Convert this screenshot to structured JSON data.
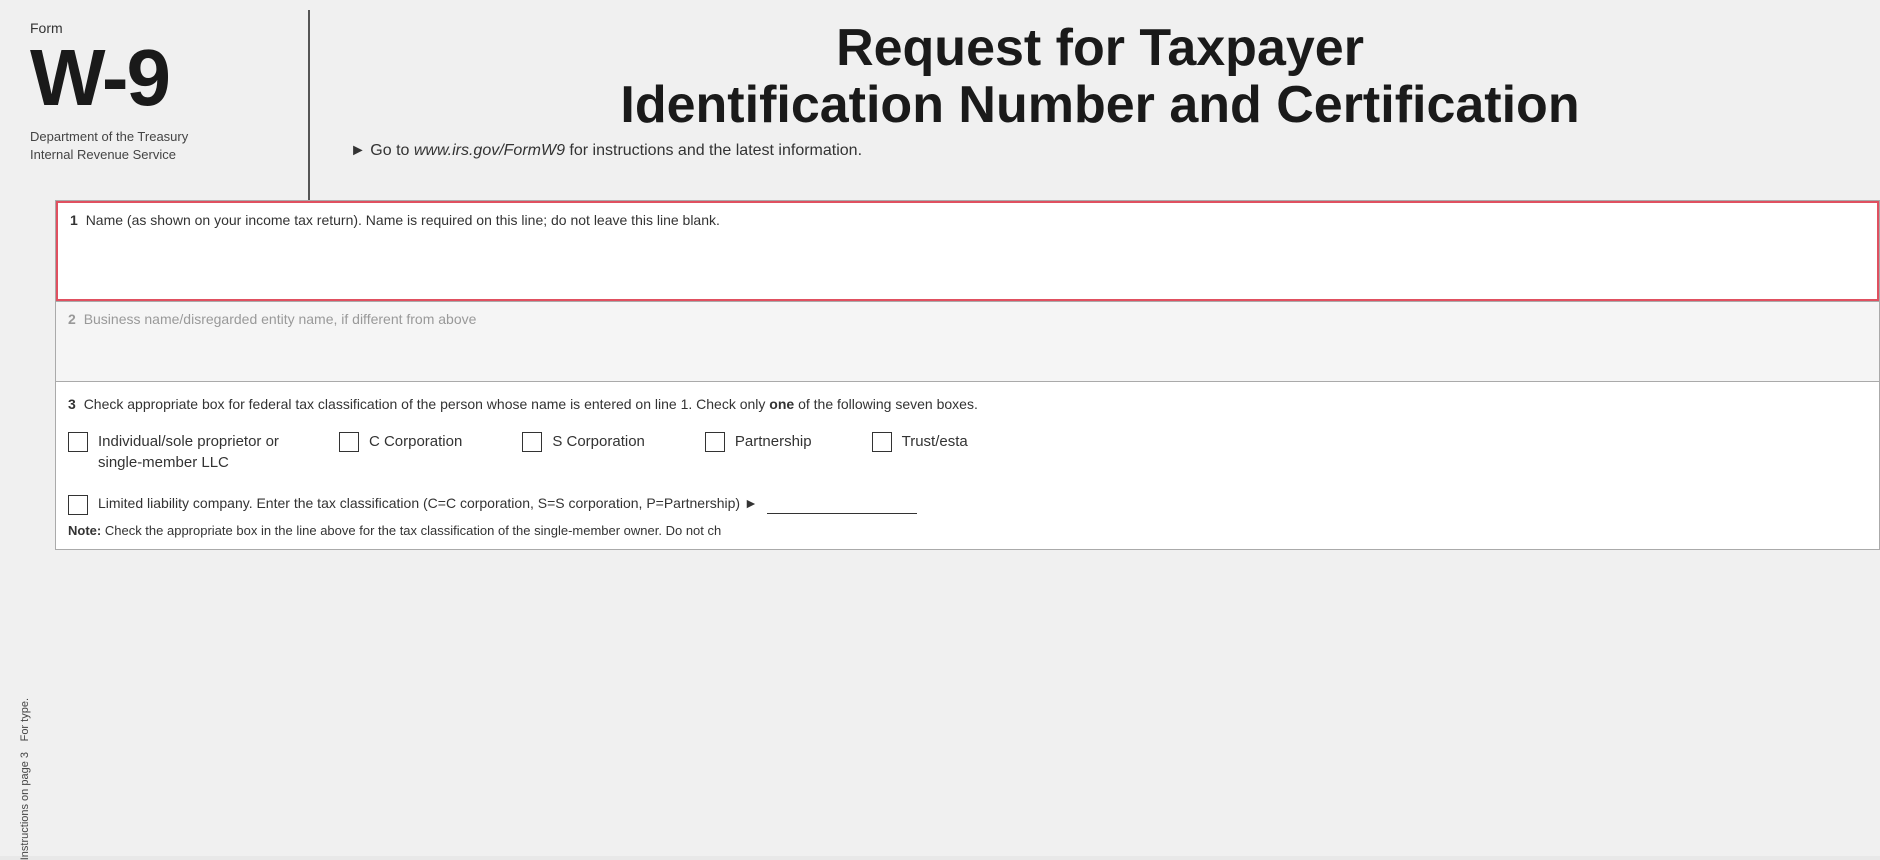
{
  "header": {
    "form_label": "Form",
    "form_number": "W-9",
    "title_line1": "Request for Taxpayer",
    "title_line2": "Identification Number and Certification",
    "department": "Department of the Treasury",
    "revenue_service": "Internal Revenue Service",
    "irs_instruction": "► Go to ",
    "irs_url": "www.irs.gov/FormW9",
    "irs_instruction_end": " for instructions and the latest information."
  },
  "sidebar": {
    "rotated_text1": "For type.",
    "rotated_text2": "Instructions on page 3"
  },
  "fields": {
    "field1": {
      "number": "1",
      "label": "Name (as shown on your income tax return). Name is required on this line; do not leave this line blank."
    },
    "field2": {
      "number": "2",
      "label": "Business name/disregarded entity name, if different from above"
    },
    "field3": {
      "number": "3",
      "label": "Check appropriate box for federal tax classification of the person whose name is entered on line 1. Check only ",
      "label_bold": "one",
      "label_end": " of the following seven boxes."
    }
  },
  "checkboxes": [
    {
      "id": "individual",
      "label_line1": "Individual/sole proprietor or",
      "label_line2": "single-member LLC"
    },
    {
      "id": "c_corp",
      "label_line1": "C Corporation",
      "label_line2": ""
    },
    {
      "id": "s_corp",
      "label_line1": "S Corporation",
      "label_line2": ""
    },
    {
      "id": "partnership",
      "label_line1": "Partnership",
      "label_line2": ""
    },
    {
      "id": "trust",
      "label_line1": "Trust/esta",
      "label_line2": ""
    }
  ],
  "llc_row": {
    "checkbox_id": "llc",
    "text": "Limited liability company. Enter the tax classification (C=C corporation, S=S corporation, P=Partnership) ►"
  },
  "note_row": {
    "bold_part": "Note:",
    "text": " Check the appropriate box in the line above for the tax classification of the single-member owner.  Do not ch"
  }
}
